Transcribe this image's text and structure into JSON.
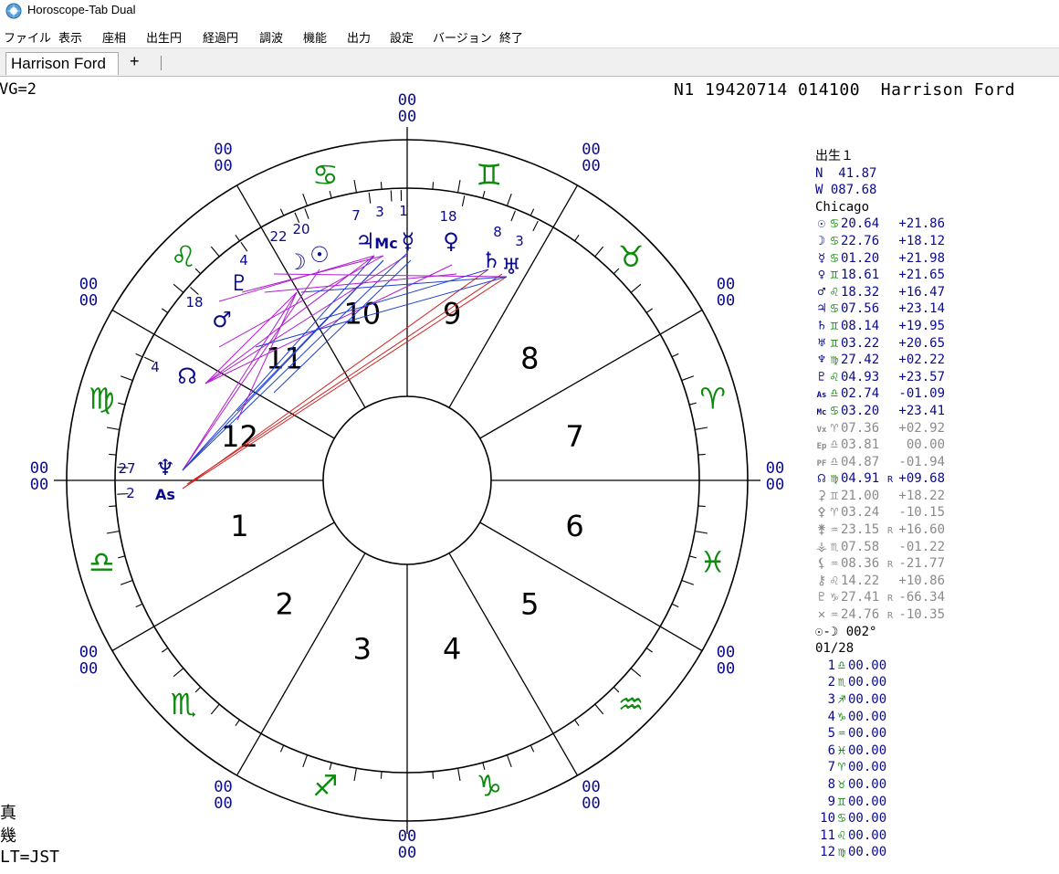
{
  "window": {
    "title": "Horoscope-Tab Dual"
  },
  "menu": [
    "ファイル",
    "表示",
    "座相",
    "出生円",
    "経過円",
    "調波",
    "機能",
    "出力",
    "設定",
    "バージョン",
    "終了"
  ],
  "tabs": {
    "active": "Harrison Ford",
    "add": "+"
  },
  "header": {
    "vg": "VG=2",
    "info": "N1 19420714 014100  Harrison Ford"
  },
  "wheel": {
    "cusp_degree_label": "00",
    "house_numbers": [
      "1",
      "2",
      "3",
      "4",
      "5",
      "6",
      "7",
      "8",
      "9",
      "10",
      "11",
      "12"
    ],
    "zodiac_signs": [
      {
        "sign": "aries",
        "glyph": "♈"
      },
      {
        "sign": "taurus",
        "glyph": "♉"
      },
      {
        "sign": "gemini",
        "glyph": "♊"
      },
      {
        "sign": "cancer",
        "glyph": "♋"
      },
      {
        "sign": "leo",
        "glyph": "♌"
      },
      {
        "sign": "virgo",
        "glyph": "♍"
      },
      {
        "sign": "libra",
        "glyph": "♎"
      },
      {
        "sign": "scorpio",
        "glyph": "♏"
      },
      {
        "sign": "sagittarius",
        "glyph": "♐"
      },
      {
        "sign": "capricorn",
        "glyph": "♑"
      },
      {
        "sign": "aquarius",
        "glyph": "♒"
      },
      {
        "sign": "pisces",
        "glyph": "♓"
      }
    ],
    "planets": [
      {
        "name": "sun",
        "glyph": "☉",
        "degree": "20"
      },
      {
        "name": "moon",
        "glyph": "☽",
        "degree": "22"
      },
      {
        "name": "mercury",
        "glyph": "☿",
        "degree": "1"
      },
      {
        "name": "venus",
        "glyph": "♀",
        "degree": "18"
      },
      {
        "name": "mars",
        "glyph": "♂",
        "degree": "18"
      },
      {
        "name": "jupiter",
        "glyph": "♃",
        "degree": "7"
      },
      {
        "name": "saturn",
        "glyph": "♄",
        "degree": "8"
      },
      {
        "name": "uranus",
        "glyph": "♅",
        "degree": "3"
      },
      {
        "name": "neptune",
        "glyph": "♆",
        "degree": "27"
      },
      {
        "name": "pluto",
        "glyph": "♇",
        "degree": "4"
      },
      {
        "name": "node",
        "glyph": "☊",
        "degree": "4"
      },
      {
        "name": "ascendant",
        "glyph": "As",
        "degree": "2"
      },
      {
        "name": "midheaven",
        "glyph": "Mc",
        "degree": "3"
      }
    ]
  },
  "panel": {
    "chart_label": "出生１",
    "lat": "N  41.87",
    "lon": "W 087.68",
    "place": "Chicago",
    "bodies": [
      {
        "name": "sun",
        "glyph": "☉",
        "sign": "♋",
        "lon": "20.64",
        "r": "",
        "lat": "+21.86",
        "style": "blue"
      },
      {
        "name": "moon",
        "glyph": "☽",
        "sign": "♋",
        "lon": "22.76",
        "r": "",
        "lat": "+18.12",
        "style": "blue"
      },
      {
        "name": "mercury",
        "glyph": "☿",
        "sign": "♋",
        "lon": "01.20",
        "r": "",
        "lat": "+21.98",
        "style": "blue"
      },
      {
        "name": "venus",
        "glyph": "♀",
        "sign": "♊",
        "lon": "18.61",
        "r": "",
        "lat": "+21.65",
        "style": "blue"
      },
      {
        "name": "mars",
        "glyph": "♂",
        "sign": "♌",
        "lon": "18.32",
        "r": "",
        "lat": "+16.47",
        "style": "blue"
      },
      {
        "name": "jupiter",
        "glyph": "♃",
        "sign": "♋",
        "lon": "07.56",
        "r": "",
        "lat": "+23.14",
        "style": "blue"
      },
      {
        "name": "saturn",
        "glyph": "♄",
        "sign": "♊",
        "lon": "08.14",
        "r": "",
        "lat": "+19.95",
        "style": "blue"
      },
      {
        "name": "uranus",
        "glyph": "♅",
        "sign": "♊",
        "lon": "03.22",
        "r": "",
        "lat": "+20.65",
        "style": "blue"
      },
      {
        "name": "neptune",
        "glyph": "♆",
        "sign": "♍",
        "lon": "27.42",
        "r": "",
        "lat": "+02.22",
        "style": "blue"
      },
      {
        "name": "pluto",
        "glyph": "♇",
        "sign": "♌",
        "lon": "04.93",
        "r": "",
        "lat": "+23.57",
        "style": "blue"
      },
      {
        "name": "ascendant",
        "glyph": "As",
        "sign": "♎",
        "lon": "02.74",
        "r": "",
        "lat": "-01.09",
        "style": "blue"
      },
      {
        "name": "midheaven",
        "glyph": "Mc",
        "sign": "♋",
        "lon": "03.20",
        "r": "",
        "lat": "+23.41",
        "style": "blue"
      },
      {
        "name": "vertex",
        "glyph": "Vx",
        "sign": "♈",
        "lon": "07.36",
        "r": "",
        "lat": "+02.92",
        "style": "gray"
      },
      {
        "name": "east-point",
        "glyph": "Ep",
        "sign": "♎",
        "lon": "03.81",
        "r": "",
        "lat": " 00.00",
        "style": "gray"
      },
      {
        "name": "part-of-fortune",
        "glyph": "PF",
        "sign": "♎",
        "lon": "04.87",
        "r": "",
        "lat": "-01.94",
        "style": "gray"
      },
      {
        "name": "node",
        "glyph": "☊",
        "sign": "♍",
        "lon": "04.91",
        "r": "R",
        "lat": "+09.68",
        "style": "blue"
      },
      {
        "name": "ceres",
        "glyph": "⚳",
        "sign": "♊",
        "lon": "21.00",
        "r": "",
        "lat": "+18.22",
        "style": "gray"
      },
      {
        "name": "pallas",
        "glyph": "⚴",
        "sign": "♈",
        "lon": "03.24",
        "r": "",
        "lat": "-10.15",
        "style": "gray"
      },
      {
        "name": "juno",
        "glyph": "⚵",
        "sign": "♒",
        "lon": "23.15",
        "r": "R",
        "lat": "+16.60",
        "style": "gray"
      },
      {
        "name": "vesta",
        "glyph": "⚶",
        "sign": "♏",
        "lon": "07.58",
        "r": "",
        "lat": "-01.22",
        "style": "gray"
      },
      {
        "name": "lilith",
        "glyph": "⚸",
        "sign": "♒",
        "lon": "08.36",
        "r": "R",
        "lat": "-21.77",
        "style": "gray"
      },
      {
        "name": "chiron",
        "glyph": "⚷",
        "sign": "♌",
        "lon": "14.22",
        "r": "",
        "lat": "+10.86",
        "style": "gray"
      },
      {
        "name": "pluto-alt",
        "glyph": "♇",
        "sign": "♑",
        "lon": "27.41",
        "r": "R",
        "lat": "-66.34",
        "style": "gray"
      },
      {
        "name": "other",
        "glyph": "✕",
        "sign": "♒",
        "lon": "24.76",
        "r": "R",
        "lat": "-10.35",
        "style": "gray"
      }
    ],
    "sun_moon_label": "☉-☽ 002°",
    "phase": "01/28",
    "houses": [
      {
        "num": "1",
        "sign": "♎",
        "deg": "00.00"
      },
      {
        "num": "2",
        "sign": "♏",
        "deg": "00.00"
      },
      {
        "num": "3",
        "sign": "♐",
        "deg": "00.00"
      },
      {
        "num": "4",
        "sign": "♑",
        "deg": "00.00"
      },
      {
        "num": "5",
        "sign": "♒",
        "deg": "00.00"
      },
      {
        "num": "6",
        "sign": "♓",
        "deg": "00.00"
      },
      {
        "num": "7",
        "sign": "♈",
        "deg": "00.00"
      },
      {
        "num": "8",
        "sign": "♉",
        "deg": "00.00"
      },
      {
        "num": "9",
        "sign": "♊",
        "deg": "00.00"
      },
      {
        "num": "10",
        "sign": "♋",
        "deg": "00.00"
      },
      {
        "num": "11",
        "sign": "♌",
        "deg": "00.00"
      },
      {
        "num": "12",
        "sign": "♍",
        "deg": "00.00"
      }
    ]
  },
  "footer": {
    "line1": "真",
    "line2": "幾",
    "line3": "LT=JST"
  },
  "colors": {
    "sign_green": "#0b8a0b",
    "planet_blue": "#0a0a8c",
    "aspect_blue": "#1f3fd0",
    "aspect_purple": "#b01ecf",
    "aspect_red": "#d02020",
    "wheel_line": "#000000"
  }
}
